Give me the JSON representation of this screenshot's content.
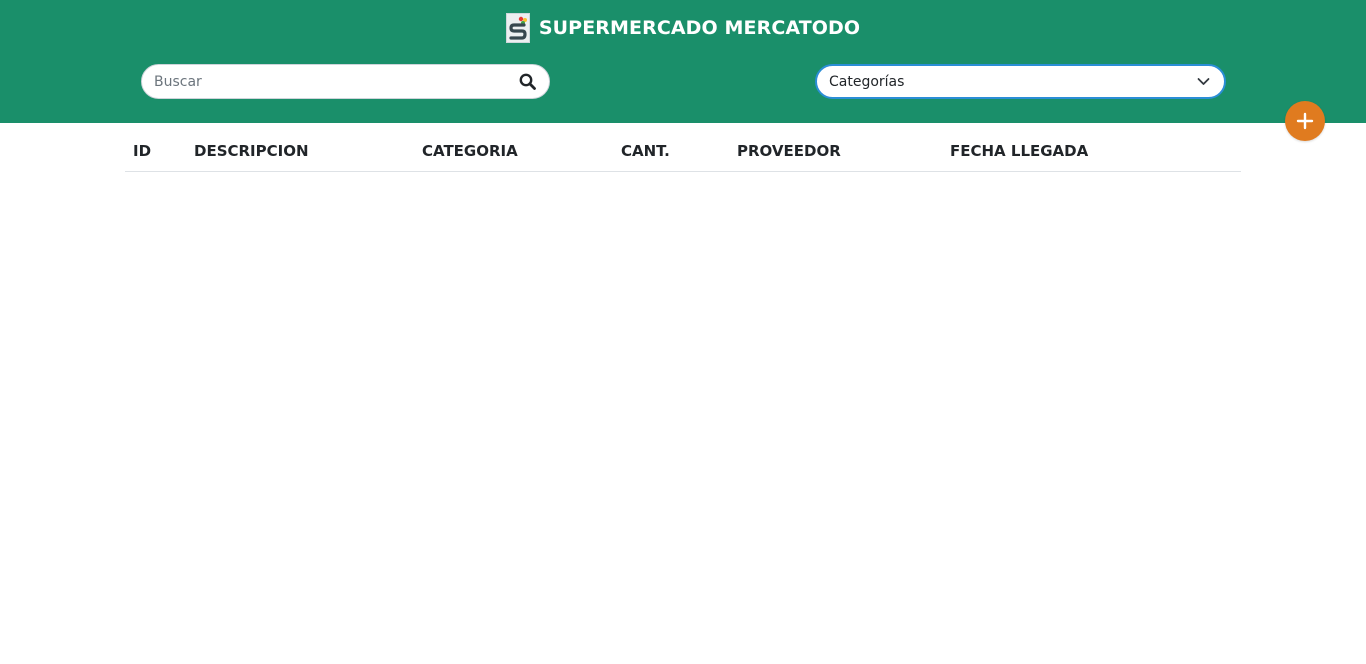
{
  "header": {
    "title": "SUPERMERCADO MERCATODO",
    "background_color": "#1a8f6a",
    "logo_icon": "store-logo-icon"
  },
  "search": {
    "placeholder": "Buscar",
    "value": "",
    "icon": "search-icon"
  },
  "category_filter": {
    "selected": "Categorías",
    "icon": "chevron-down-icon",
    "border_color": "#2b8ed6"
  },
  "add_button": {
    "icon": "plus-icon",
    "color": "#e07b1f"
  },
  "table": {
    "columns": [
      "ID",
      "DESCRIPCION",
      "CATEGORIA",
      "CANT.",
      "PROVEEDOR",
      "FECHA LLEGADA"
    ],
    "rows": []
  }
}
